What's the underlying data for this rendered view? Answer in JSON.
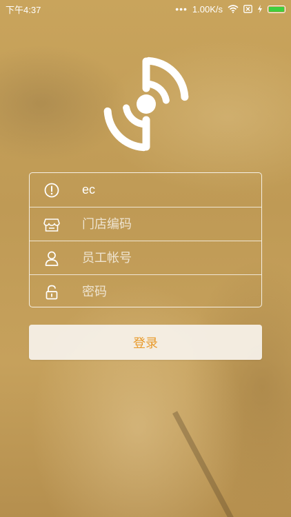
{
  "status_bar": {
    "time": "下午4:37",
    "dots": "•••",
    "speed": "1.00K/s",
    "wifi_icon": "wifi-icon",
    "sim_icon": "sim-off-icon",
    "charge_icon": "bolt-icon",
    "battery_icon": "battery-icon",
    "battery_color": "#3ecf3e"
  },
  "logo": {
    "icon": "target-logo-icon"
  },
  "form": {
    "fields": [
      {
        "icon": "info-icon",
        "value": "ec",
        "placeholder": ""
      },
      {
        "icon": "store-icon",
        "value": "",
        "placeholder": "门店编码"
      },
      {
        "icon": "user-icon",
        "value": "",
        "placeholder": "员工帐号"
      },
      {
        "icon": "lock-icon",
        "value": "",
        "placeholder": "密码"
      }
    ]
  },
  "login_button": {
    "label": "登录",
    "color": "#e89a2b"
  },
  "colors": {
    "background": "#c3a05a",
    "text": "#ffffff"
  }
}
